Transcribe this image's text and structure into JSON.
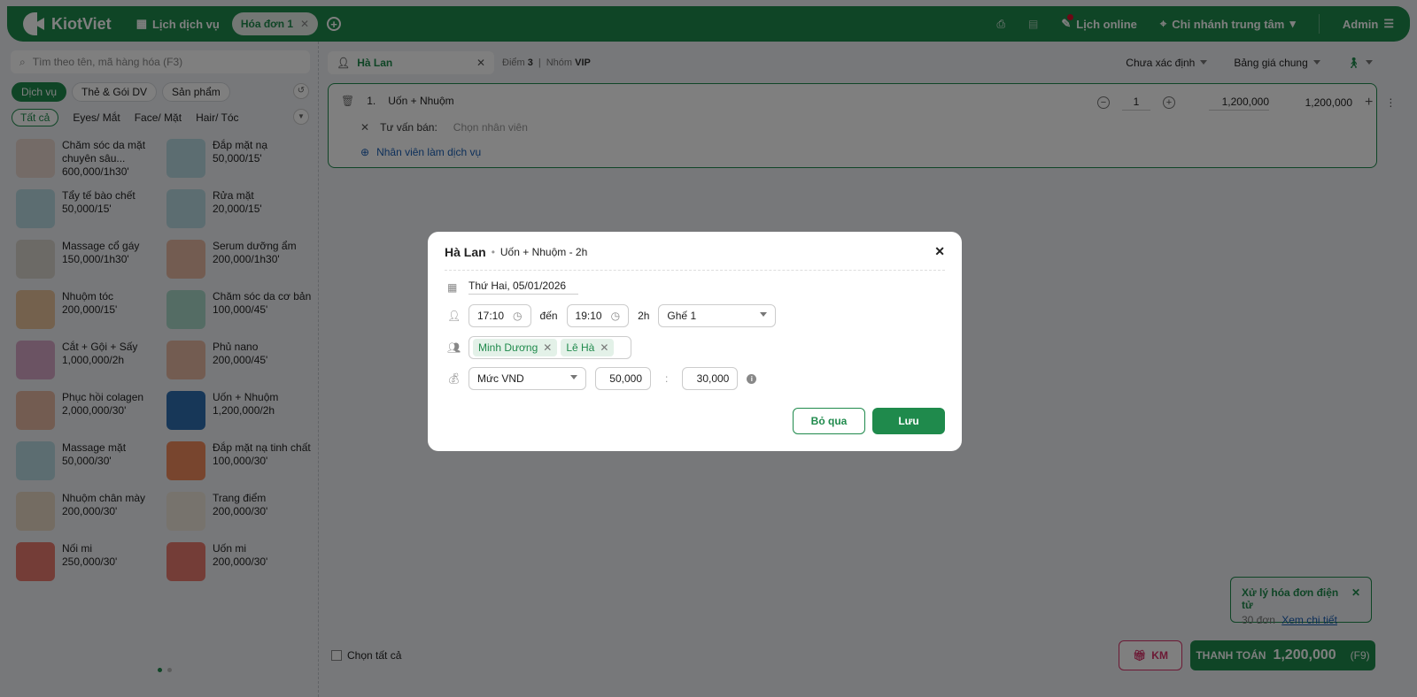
{
  "header": {
    "brand": "KiotViet",
    "schedule": "Lịch dịch vụ",
    "tab": "Hóa đơn 1",
    "online": "Lịch online",
    "branch": "Chi nhánh trung tâm",
    "user": "Admin"
  },
  "left": {
    "search_placeholder": "Tìm theo tên, mã hàng hóa (F3)",
    "types": [
      "Dịch vụ",
      "Thẻ & Gói DV",
      "Sản phẩm"
    ],
    "categories": [
      "Tất cả",
      "Eyes/ Mắt",
      "Face/ Mặt",
      "Hair/ Tóc"
    ],
    "products": [
      {
        "name": "Chăm sóc da mặt chuyên sâu...",
        "price": "600,000/1h30'",
        "color": "#e8d6cf"
      },
      {
        "name": "Đắp mặt nạ",
        "price": "50,000/15'",
        "color": "#b9dbe3"
      },
      {
        "name": "Tẩy tế bào chết",
        "price": "50,000/15'",
        "color": "#b9dbe3"
      },
      {
        "name": "Rửa mặt",
        "price": "20,000/15'",
        "color": "#b9dbe3"
      },
      {
        "name": "Massage cổ gáy",
        "price": "150,000/1h30'",
        "color": "#d9d4cc"
      },
      {
        "name": "Serum dưỡng ẩm",
        "price": "200,000/1h30'",
        "color": "#e7b9a3"
      },
      {
        "name": "Nhuộm tóc",
        "price": "200,000/15'",
        "color": "#e9c39a"
      },
      {
        "name": "Chăm sóc da cơ bản",
        "price": "100,000/45'",
        "color": "#a8d9c8"
      },
      {
        "name": "Cắt + Gội + Sấy",
        "price": "1,000,000/2h",
        "color": "#d7a6c6"
      },
      {
        "name": "Phủ nano",
        "price": "200,000/45'",
        "color": "#e7b9a3"
      },
      {
        "name": "Phục hồi colagen",
        "price": "2,000,000/30'",
        "color": "#e7b9a3"
      },
      {
        "name": "Uốn + Nhuộm",
        "price": "1,200,000/2h",
        "color": "#2f6fb0"
      },
      {
        "name": "Massage mặt",
        "price": "50,000/30'",
        "color": "#b9dbe3"
      },
      {
        "name": "Đắp mặt nạ tinh chất",
        "price": "100,000/30'",
        "color": "#f08a5d"
      },
      {
        "name": "Nhuộm chân mày",
        "price": "200,000/30'",
        "color": "#e9d9c4"
      },
      {
        "name": "Trang điểm",
        "price": "200,000/30'",
        "color": "#efe6da"
      },
      {
        "name": "Nối mi",
        "price": "250,000/30'",
        "color": "#e97a6e"
      },
      {
        "name": "Uốn mi",
        "price": "200,000/30'",
        "color": "#e97a6e"
      }
    ]
  },
  "order": {
    "customer": "Hà Lan",
    "points_label": "Điểm",
    "points": "3",
    "group_label": "Nhóm",
    "group": "VIP",
    "status": "Chưa xác định",
    "pricebook": "Bảng giá chung",
    "item": {
      "index": "1.",
      "name": "Uốn + Nhuộm",
      "qty": "1",
      "price": "1,200,000",
      "total": "1,200,000",
      "consultant_label": "Tư vấn bán:",
      "consultant_placeholder": "Chọn nhân viên",
      "staff_link": "Nhân viên làm dịch vụ"
    },
    "select_all": "Chọn tất cả"
  },
  "notice": {
    "title": "Xử lý hóa đơn điện tử",
    "count": "30 đơn",
    "link": "Xem chi tiết"
  },
  "footer": {
    "km": "KM",
    "pay": "THANH TOÁN",
    "amount": "1,200,000",
    "hotkey": "(F9)"
  },
  "modal": {
    "customer": "Hà Lan",
    "service": "Uốn + Nhuộm - 2h",
    "date": "Thứ Hai, 05/01/2026",
    "start": "17:10",
    "to": "đến",
    "end": "19:10",
    "duration": "2h",
    "seat": "Ghế 1",
    "staff": [
      "Minh Dương",
      "Lê Hà"
    ],
    "commission_type": "Mức VND",
    "value1": "50,000",
    "ratio_sep": ":",
    "value2": "30,000",
    "cancel": "Bỏ qua",
    "save": "Lưu"
  },
  "colors": {
    "brand": "#1f8a4c",
    "promo": "#d8336a"
  }
}
